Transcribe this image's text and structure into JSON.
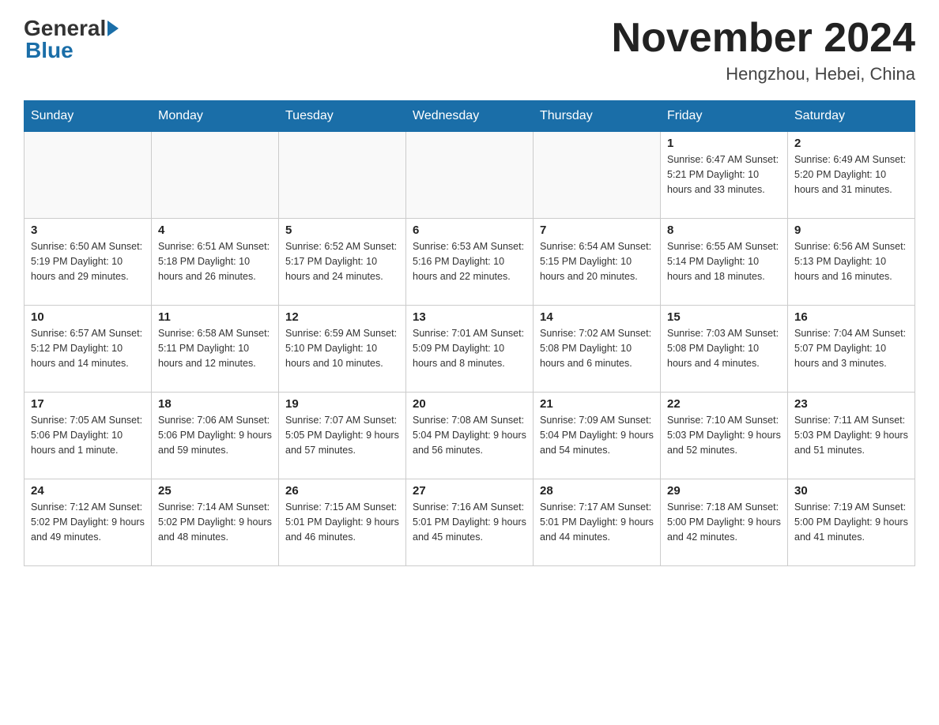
{
  "header": {
    "logo_general": "General",
    "logo_blue": "Blue",
    "month_year": "November 2024",
    "location": "Hengzhou, Hebei, China"
  },
  "days_of_week": [
    "Sunday",
    "Monday",
    "Tuesday",
    "Wednesday",
    "Thursday",
    "Friday",
    "Saturday"
  ],
  "weeks": [
    {
      "days": [
        {
          "number": "",
          "info": ""
        },
        {
          "number": "",
          "info": ""
        },
        {
          "number": "",
          "info": ""
        },
        {
          "number": "",
          "info": ""
        },
        {
          "number": "",
          "info": ""
        },
        {
          "number": "1",
          "info": "Sunrise: 6:47 AM\nSunset: 5:21 PM\nDaylight: 10 hours\nand 33 minutes."
        },
        {
          "number": "2",
          "info": "Sunrise: 6:49 AM\nSunset: 5:20 PM\nDaylight: 10 hours\nand 31 minutes."
        }
      ]
    },
    {
      "days": [
        {
          "number": "3",
          "info": "Sunrise: 6:50 AM\nSunset: 5:19 PM\nDaylight: 10 hours\nand 29 minutes."
        },
        {
          "number": "4",
          "info": "Sunrise: 6:51 AM\nSunset: 5:18 PM\nDaylight: 10 hours\nand 26 minutes."
        },
        {
          "number": "5",
          "info": "Sunrise: 6:52 AM\nSunset: 5:17 PM\nDaylight: 10 hours\nand 24 minutes."
        },
        {
          "number": "6",
          "info": "Sunrise: 6:53 AM\nSunset: 5:16 PM\nDaylight: 10 hours\nand 22 minutes."
        },
        {
          "number": "7",
          "info": "Sunrise: 6:54 AM\nSunset: 5:15 PM\nDaylight: 10 hours\nand 20 minutes."
        },
        {
          "number": "8",
          "info": "Sunrise: 6:55 AM\nSunset: 5:14 PM\nDaylight: 10 hours\nand 18 minutes."
        },
        {
          "number": "9",
          "info": "Sunrise: 6:56 AM\nSunset: 5:13 PM\nDaylight: 10 hours\nand 16 minutes."
        }
      ]
    },
    {
      "days": [
        {
          "number": "10",
          "info": "Sunrise: 6:57 AM\nSunset: 5:12 PM\nDaylight: 10 hours\nand 14 minutes."
        },
        {
          "number": "11",
          "info": "Sunrise: 6:58 AM\nSunset: 5:11 PM\nDaylight: 10 hours\nand 12 minutes."
        },
        {
          "number": "12",
          "info": "Sunrise: 6:59 AM\nSunset: 5:10 PM\nDaylight: 10 hours\nand 10 minutes."
        },
        {
          "number": "13",
          "info": "Sunrise: 7:01 AM\nSunset: 5:09 PM\nDaylight: 10 hours\nand 8 minutes."
        },
        {
          "number": "14",
          "info": "Sunrise: 7:02 AM\nSunset: 5:08 PM\nDaylight: 10 hours\nand 6 minutes."
        },
        {
          "number": "15",
          "info": "Sunrise: 7:03 AM\nSunset: 5:08 PM\nDaylight: 10 hours\nand 4 minutes."
        },
        {
          "number": "16",
          "info": "Sunrise: 7:04 AM\nSunset: 5:07 PM\nDaylight: 10 hours\nand 3 minutes."
        }
      ]
    },
    {
      "days": [
        {
          "number": "17",
          "info": "Sunrise: 7:05 AM\nSunset: 5:06 PM\nDaylight: 10 hours\nand 1 minute."
        },
        {
          "number": "18",
          "info": "Sunrise: 7:06 AM\nSunset: 5:06 PM\nDaylight: 9 hours\nand 59 minutes."
        },
        {
          "number": "19",
          "info": "Sunrise: 7:07 AM\nSunset: 5:05 PM\nDaylight: 9 hours\nand 57 minutes."
        },
        {
          "number": "20",
          "info": "Sunrise: 7:08 AM\nSunset: 5:04 PM\nDaylight: 9 hours\nand 56 minutes."
        },
        {
          "number": "21",
          "info": "Sunrise: 7:09 AM\nSunset: 5:04 PM\nDaylight: 9 hours\nand 54 minutes."
        },
        {
          "number": "22",
          "info": "Sunrise: 7:10 AM\nSunset: 5:03 PM\nDaylight: 9 hours\nand 52 minutes."
        },
        {
          "number": "23",
          "info": "Sunrise: 7:11 AM\nSunset: 5:03 PM\nDaylight: 9 hours\nand 51 minutes."
        }
      ]
    },
    {
      "days": [
        {
          "number": "24",
          "info": "Sunrise: 7:12 AM\nSunset: 5:02 PM\nDaylight: 9 hours\nand 49 minutes."
        },
        {
          "number": "25",
          "info": "Sunrise: 7:14 AM\nSunset: 5:02 PM\nDaylight: 9 hours\nand 48 minutes."
        },
        {
          "number": "26",
          "info": "Sunrise: 7:15 AM\nSunset: 5:01 PM\nDaylight: 9 hours\nand 46 minutes."
        },
        {
          "number": "27",
          "info": "Sunrise: 7:16 AM\nSunset: 5:01 PM\nDaylight: 9 hours\nand 45 minutes."
        },
        {
          "number": "28",
          "info": "Sunrise: 7:17 AM\nSunset: 5:01 PM\nDaylight: 9 hours\nand 44 minutes."
        },
        {
          "number": "29",
          "info": "Sunrise: 7:18 AM\nSunset: 5:00 PM\nDaylight: 9 hours\nand 42 minutes."
        },
        {
          "number": "30",
          "info": "Sunrise: 7:19 AM\nSunset: 5:00 PM\nDaylight: 9 hours\nand 41 minutes."
        }
      ]
    }
  ]
}
